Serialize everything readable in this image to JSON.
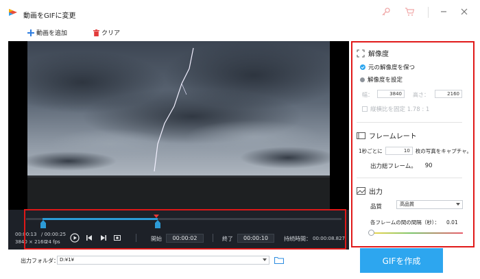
{
  "window": {
    "title": "動画をGIFに変更"
  },
  "toolbar": {
    "add_label": "動画を追加",
    "clear_label": "クリア"
  },
  "player": {
    "elapsed": "00:00:13",
    "total": "/ 00:00:25",
    "resolution": "3840 × 2160",
    "fps": "24 fps",
    "start_label": "開始",
    "start_value": "00:00:02",
    "end_label": "終了",
    "end_value": "00:00:10",
    "duration_label": "持続時間：",
    "duration_value": "00:00:08.827"
  },
  "settings": {
    "resolution": {
      "title": "解像度",
      "opt_keep": "元の解像度を保つ",
      "opt_set": "解像度を設定",
      "width_label": "幅：",
      "width_value": "3840",
      "height_label": "高さ：",
      "height_value": "2160",
      "aspect_label": "縦横比を固定  1.78 : 1"
    },
    "framerate": {
      "title": "フレームレート",
      "per_sec_prefix": "1秒ごとに",
      "per_sec_value": "10",
      "per_sec_suffix": "枚の写真をキャプチャ。",
      "total_label": "出力総フレーム。",
      "total_value": "90"
    },
    "output": {
      "title": "出力",
      "quality_label": "品質",
      "quality_value": "高品質",
      "interval_label": "各フレームの間の間隔（秒）：",
      "interval_value": "0.01"
    }
  },
  "bottom": {
    "folder_label": "出力フォルダ：",
    "folder_path": "D:¥1¥",
    "create_label": "GIFを作成"
  },
  "colors": {
    "accent": "#2da6ef",
    "highlight": "#e01818",
    "timeline": "#2c9bd7"
  }
}
